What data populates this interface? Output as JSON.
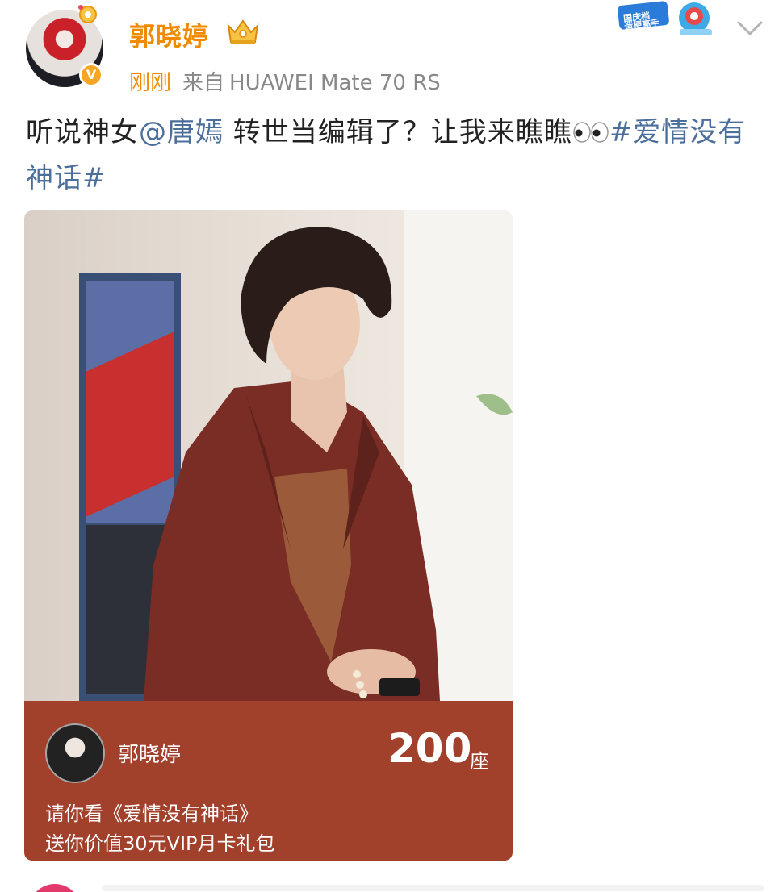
{
  "post": {
    "author": "郭晓婷",
    "time": "刚刚",
    "source_prefix": "来自",
    "device": "HUAWEI Mate 70 RS",
    "text_before_mention": "听说神女",
    "mention": "@唐嫣",
    "text_after_mention": " 转世当编辑了？让我来瞧瞧",
    "hashtag": "#爱情没有神话#"
  },
  "card": {
    "host_name": "郭晓婷",
    "seat_count": "200",
    "seat_unit": "座",
    "invite_text": "请你看《爱情没有神话》",
    "gift_text": "送你价值30元VIP月卡礼包"
  },
  "badges": {
    "holiday_badge_text": "国庆档 造梗高手"
  },
  "icons": {
    "verified": "verified-v-icon",
    "crown": "crown-icon",
    "more": "chevron-down-icon",
    "eyes": "eyes-emoji-icon"
  },
  "colors": {
    "username": "#f08a00",
    "link": "#4b6e9b",
    "card_footer": "#a1402b"
  }
}
